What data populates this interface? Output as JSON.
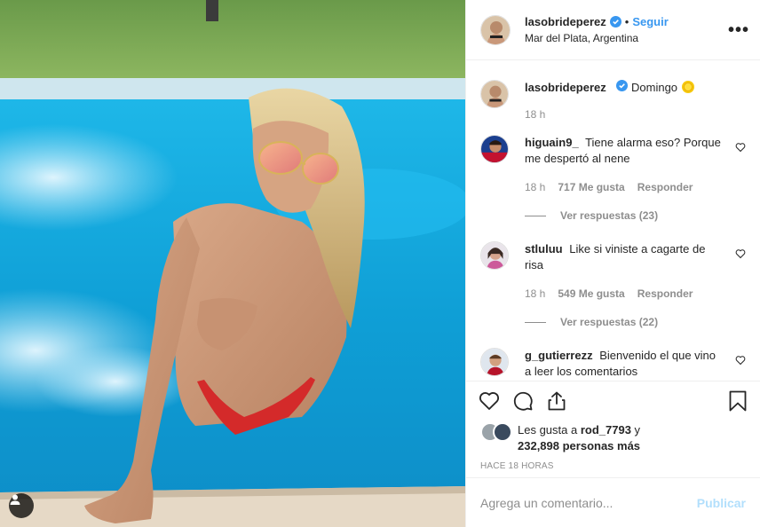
{
  "post": {
    "username": "lasobrideperez",
    "follow_label": "Seguir",
    "dot": "•",
    "location": "Mar del Plata, Argentina",
    "more_label": "•••"
  },
  "caption": {
    "username": "lasobrideperez",
    "text": "Domingo",
    "time": "18 h"
  },
  "comments": [
    {
      "username": "higuain9_",
      "text": "Tiene alarma eso? Porque me despertó al nene",
      "time": "18 h",
      "likes": "717 Me gusta",
      "reply_label": "Responder",
      "replies_label": "Ver respuestas (23)"
    },
    {
      "username": "stluluu",
      "text": "Like si viniste a cagarte de risa",
      "time": "18 h",
      "likes": "549 Me gusta",
      "reply_label": "Responder",
      "replies_label": "Ver respuestas (22)"
    },
    {
      "username": "g_gutierrezz",
      "text": "Bienvenido el que vino a leer los comentarios"
    }
  ],
  "likes": {
    "prefix": "Les gusta a ",
    "user": "rod_7793",
    "suffix": " y",
    "count": "232,898 personas más"
  },
  "timeago": "HACE 18 HORAS",
  "add_comment": {
    "placeholder": "Agrega un comentario...",
    "publish_label": "Publicar"
  },
  "colors": {
    "accent": "#3897f0",
    "publish_disabled": "#b2dffc",
    "muted": "#8e8e8e"
  },
  "icons": {
    "verified": "verified-badge-icon",
    "like": "heart-icon",
    "comment": "comment-bubble-icon",
    "share": "share-icon",
    "save": "bookmark-icon",
    "tag": "user-tag-icon",
    "emoji": "sun-emoji-icon"
  }
}
